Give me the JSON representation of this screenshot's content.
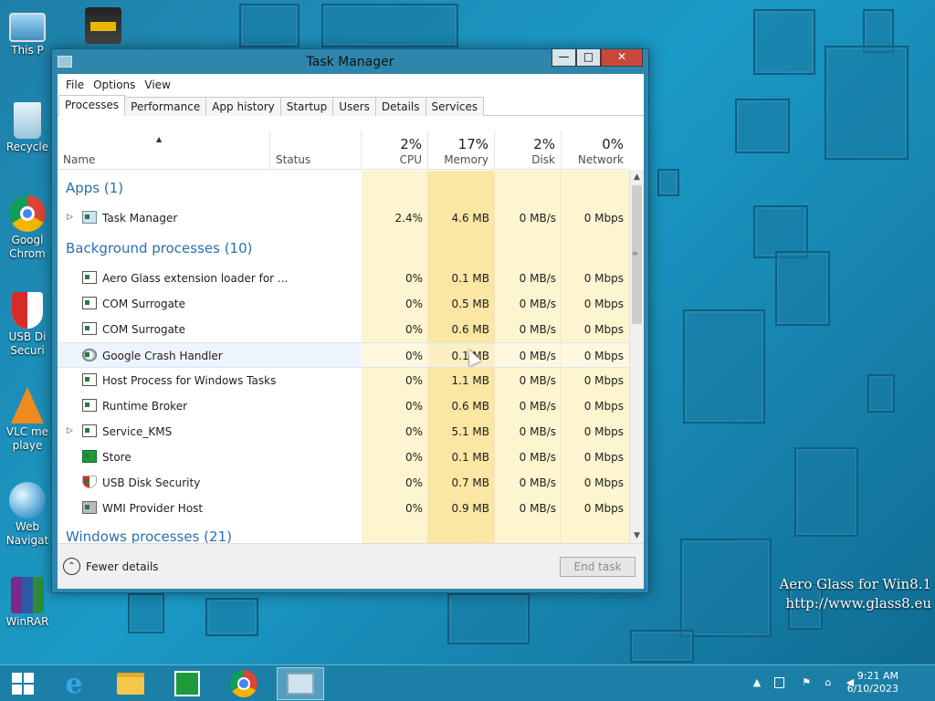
{
  "desktop": {
    "icons": [
      {
        "label": "This P",
        "icon": "this-pc-icon"
      },
      {
        "label": "Recycle",
        "icon": "recycle-bin-icon"
      },
      {
        "label": "Googl",
        "label2": "Chrom",
        "icon": "chrome-icon"
      },
      {
        "label": "USB Di",
        "label2": "Securi",
        "icon": "usb-security-icon"
      },
      {
        "label": "VLC me",
        "label2": "playe",
        "icon": "vlc-icon"
      },
      {
        "label": "Web",
        "label2": "Navigat",
        "icon": "web-navigator-icon"
      },
      {
        "label": "WinRAR",
        "icon": "winrar-icon"
      }
    ],
    "watermark_line1": "Aero Glass for Win8.1",
    "watermark_line2": "http://www.glass8.eu"
  },
  "window": {
    "title": "Task Manager",
    "minimize_glyph": "—",
    "maximize_glyph": "□",
    "close_glyph": "✕"
  },
  "menu": [
    "File",
    "Options",
    "View"
  ],
  "tabs": [
    "Processes",
    "Performance",
    "App history",
    "Startup",
    "Users",
    "Details",
    "Services"
  ],
  "columns": {
    "name": "Name",
    "status": "Status",
    "cpu": {
      "pct": "2%",
      "label": "CPU"
    },
    "memory": {
      "pct": "17%",
      "label": "Memory"
    },
    "disk": {
      "pct": "2%",
      "label": "Disk"
    },
    "network": {
      "pct": "0%",
      "label": "Network"
    }
  },
  "groups": {
    "apps": "Apps (1)",
    "background": "Background processes (10)",
    "windows": "Windows processes (21)"
  },
  "apps": [
    {
      "name": "Task Manager",
      "cpu": "2.4%",
      "mem": "4.6 MB",
      "disk": "0 MB/s",
      "net": "0 Mbps",
      "expandable": true
    }
  ],
  "background": [
    {
      "name": "Aero Glass extension loader for ...",
      "cpu": "0%",
      "mem": "0.1 MB",
      "disk": "0 MB/s",
      "net": "0 Mbps"
    },
    {
      "name": "COM Surrogate",
      "cpu": "0%",
      "mem": "0.5 MB",
      "disk": "0 MB/s",
      "net": "0 Mbps"
    },
    {
      "name": "COM Surrogate",
      "cpu": "0%",
      "mem": "0.6 MB",
      "disk": "0 MB/s",
      "net": "0 Mbps"
    },
    {
      "name": "Google Crash Handler",
      "cpu": "0%",
      "mem": "0.1 MB",
      "disk": "0 MB/s",
      "net": "0 Mbps"
    },
    {
      "name": "Host Process for Windows Tasks",
      "cpu": "0%",
      "mem": "1.1 MB",
      "disk": "0 MB/s",
      "net": "0 Mbps"
    },
    {
      "name": "Runtime Broker",
      "cpu": "0%",
      "mem": "0.6 MB",
      "disk": "0 MB/s",
      "net": "0 Mbps"
    },
    {
      "name": "Service_KMS",
      "cpu": "0%",
      "mem": "5.1 MB",
      "disk": "0 MB/s",
      "net": "0 Mbps"
    },
    {
      "name": "Store",
      "cpu": "0%",
      "mem": "0.1 MB",
      "disk": "0 MB/s",
      "net": "0 Mbps"
    },
    {
      "name": "USB Disk Security",
      "cpu": "0%",
      "mem": "0.7 MB",
      "disk": "0 MB/s",
      "net": "0 Mbps"
    },
    {
      "name": "WMI Provider Host",
      "cpu": "0%",
      "mem": "0.9 MB",
      "disk": "0 MB/s",
      "net": "0 Mbps"
    }
  ],
  "footer": {
    "fewer_details": "Fewer details",
    "end_task": "End task"
  },
  "taskbar": {
    "time": "9:21 AM",
    "date": "6/10/2023"
  },
  "colors": {
    "cpu_col": "#fdf4d0",
    "mem_col": "#fbe6a4",
    "light_col": "#fdf4d0",
    "group_text": "#2a6fb0"
  }
}
